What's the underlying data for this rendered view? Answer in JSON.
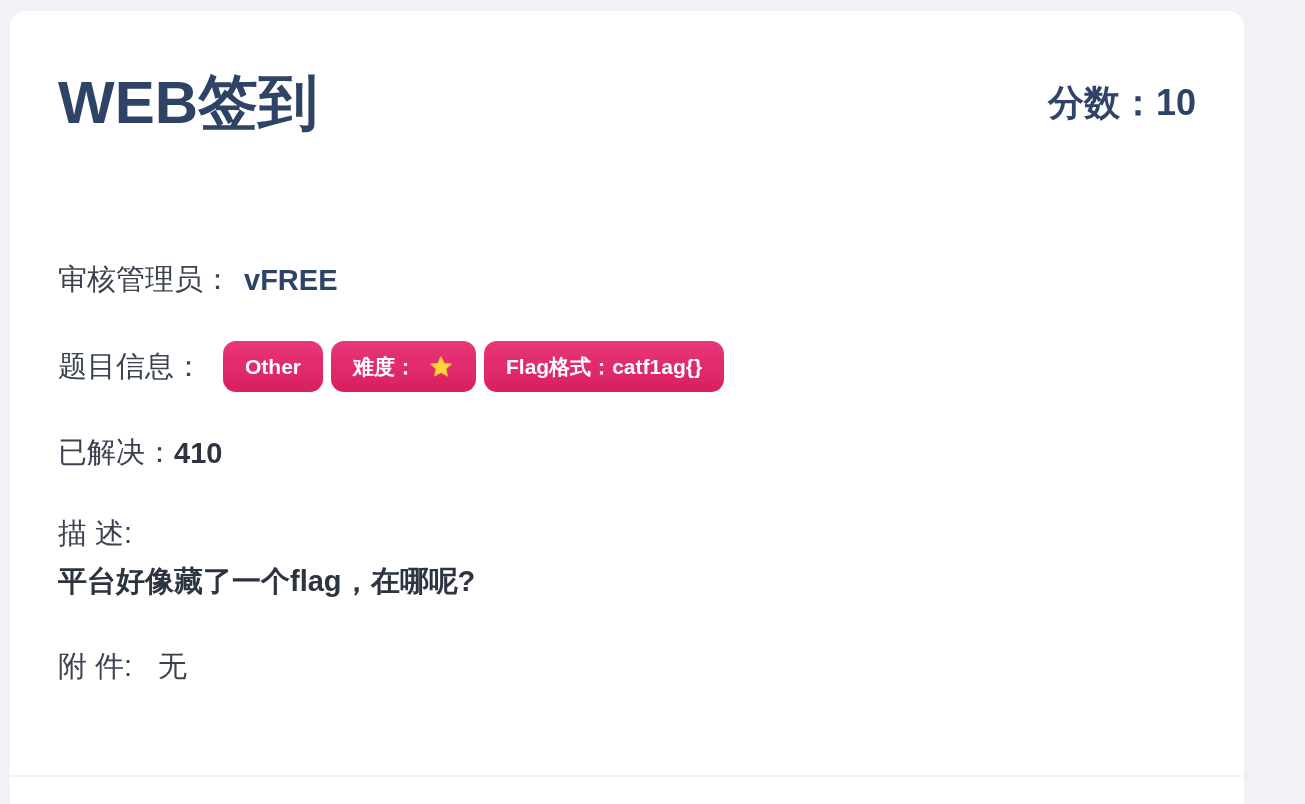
{
  "challenge": {
    "title": "WEB签到",
    "score_label": "分数：",
    "score": "10"
  },
  "reviewer": {
    "label": "审核管理员：",
    "value": "vFREE"
  },
  "info": {
    "label": "题目信息：",
    "tags": [
      {
        "kind": "text",
        "text": "Other"
      },
      {
        "kind": "difficulty",
        "text": "难度："
      },
      {
        "kind": "text",
        "text": "Flag格式：catf1ag{}"
      }
    ]
  },
  "solved": {
    "label": "已解决：",
    "value": "410"
  },
  "description": {
    "label": "描 述:",
    "text": "平台好像藏了一个flag，在哪呢?"
  },
  "attachment": {
    "label": "附 件:",
    "value": "无"
  }
}
